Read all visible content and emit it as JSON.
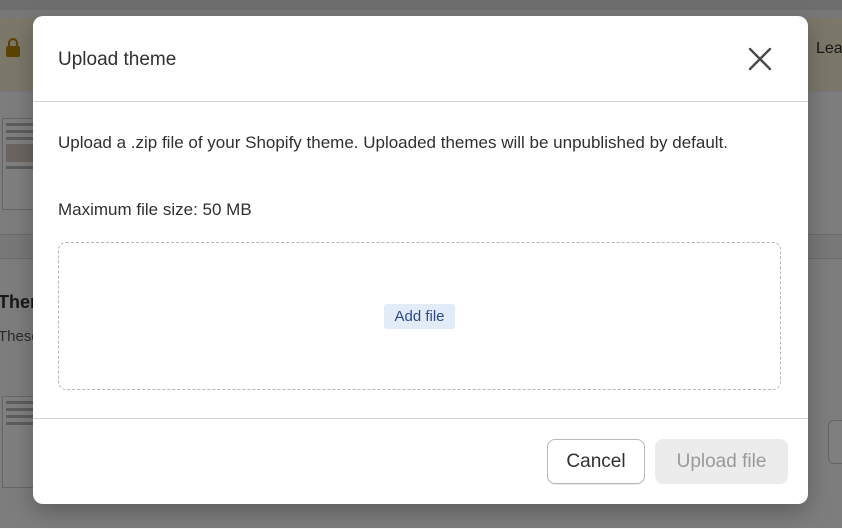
{
  "background": {
    "banner_link_text": "Lea",
    "section_heading": "Ther",
    "section_subtext": "These"
  },
  "modal": {
    "title": "Upload theme",
    "close_icon": "close-icon",
    "description": "Upload a .zip file of your Shopify theme. Uploaded themes will be unpublished by default.",
    "max_file_size": "Maximum file size: 50 MB",
    "dropzone": {
      "add_file_label": "Add file"
    },
    "footer": {
      "cancel_label": "Cancel",
      "upload_label": "Upload file",
      "upload_disabled": true
    }
  },
  "colors": {
    "overlay": "#00000080",
    "add_file_bg": "#e2ecf8",
    "add_file_text": "#2c4a8a",
    "disabled_button_bg": "#ececec",
    "disabled_button_text": "#9a9a9a"
  }
}
